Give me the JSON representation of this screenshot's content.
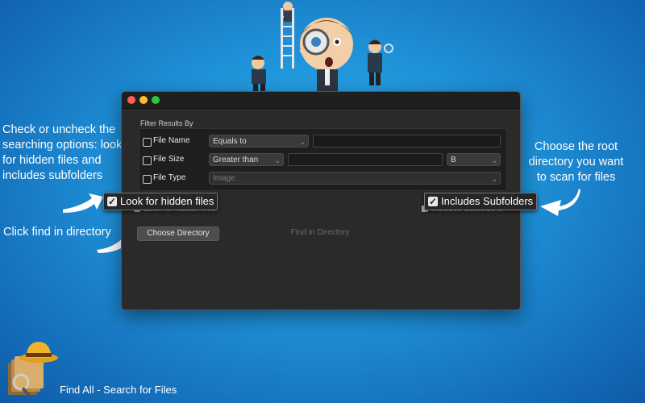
{
  "callouts": {
    "left": "Check or uncheck the searching options: look for hidden files and includes subfolders",
    "right": "Choose the root directory you want to scan for files",
    "find": "Click find in directory"
  },
  "window": {
    "filter_title": "Filter Results By",
    "rows": [
      {
        "label": "File Name",
        "select": "Equals to"
      },
      {
        "label": "File Size",
        "select": "Greater than",
        "unit": "B"
      },
      {
        "label": "File Type",
        "select": "Image"
      }
    ],
    "option_hidden": "Look for hidden files",
    "option_subfolders": "Includes Subfolders",
    "choose_button": "Choose Directory",
    "find_button": "Find in Directory"
  },
  "zoom": {
    "hidden": "Look for hidden files",
    "subfolders": "Includes Subfolders"
  },
  "app_name": "Find All - Search for Files",
  "colors": {
    "background_center": "#2fb6f0",
    "background_edge": "#0f5aa8",
    "window": "#2a2a2a"
  }
}
